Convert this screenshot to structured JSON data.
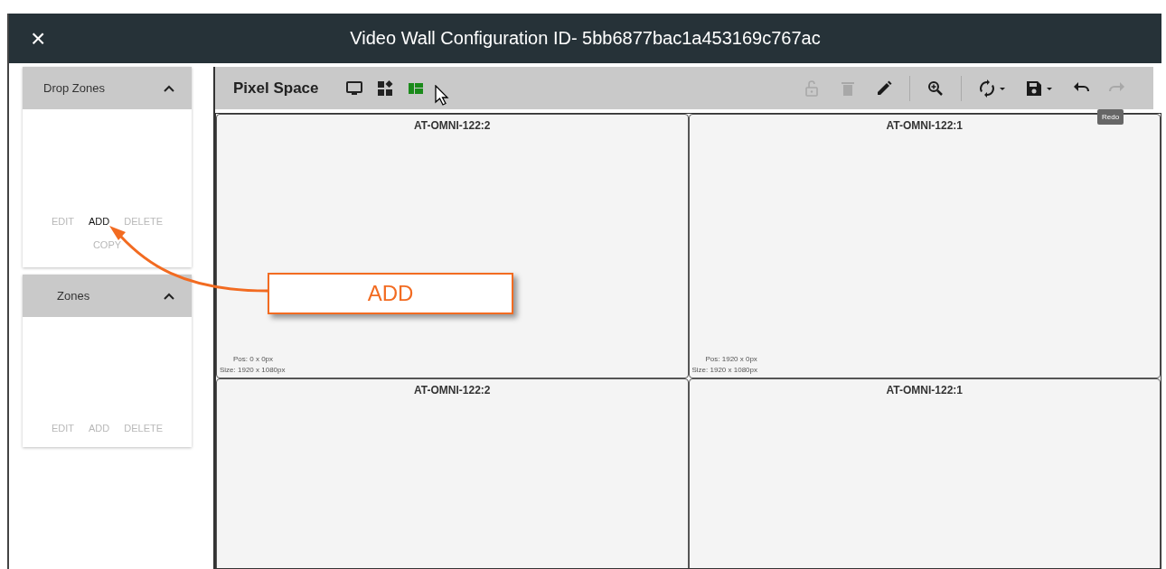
{
  "window": {
    "title": "Video Wall Configuration ID- 5bb6877bac1a453169c767ac",
    "close": "×"
  },
  "sidebar": [
    {
      "title": "Drop Zones",
      "expanded": true,
      "actions": [
        {
          "label": "EDIT",
          "disabled": true
        },
        {
          "label": "ADD",
          "disabled": false
        },
        {
          "label": "DELETE",
          "disabled": true
        },
        {
          "label": "COPY",
          "disabled": true
        }
      ]
    },
    {
      "title": "Zones",
      "expanded": true,
      "actions": [
        {
          "label": "EDIT",
          "disabled": true
        },
        {
          "label": "ADD",
          "disabled": true
        },
        {
          "label": "DELETE",
          "disabled": true
        }
      ]
    }
  ],
  "toolbar": {
    "title": "Pixel Space",
    "view_buttons": [
      {
        "kind": "monitor",
        "selected": false
      },
      {
        "kind": "widgets",
        "selected": false
      },
      {
        "kind": "layout",
        "selected": true
      }
    ],
    "tools": [
      {
        "kind": "lock",
        "disabled": true
      },
      {
        "kind": "trash",
        "disabled": true
      },
      {
        "kind": "pencil",
        "disabled": false
      },
      {
        "kind": "separator"
      },
      {
        "kind": "zoom",
        "disabled": false
      },
      {
        "kind": "separator"
      },
      {
        "kind": "sync",
        "disabled": false,
        "menu": true
      },
      {
        "kind": "save",
        "disabled": false,
        "menu": true
      },
      {
        "kind": "undo",
        "disabled": false
      },
      {
        "kind": "redo",
        "disabled": true
      }
    ],
    "tooltip": "Redo"
  },
  "canvas": {
    "displays": [
      {
        "name": "AT-OMNI-122:2",
        "pos": "Pos: 0 x 0px",
        "size": "Size: 1920 x 1080px"
      },
      {
        "name": "AT-OMNI-122:1",
        "pos": "Pos: 1920 x 0px",
        "size": "Size: 1920 x 1080px"
      },
      {
        "name": "AT-OMNI-122:2"
      },
      {
        "name": "AT-OMNI-122:1"
      }
    ]
  },
  "callout": {
    "label": "ADD"
  }
}
